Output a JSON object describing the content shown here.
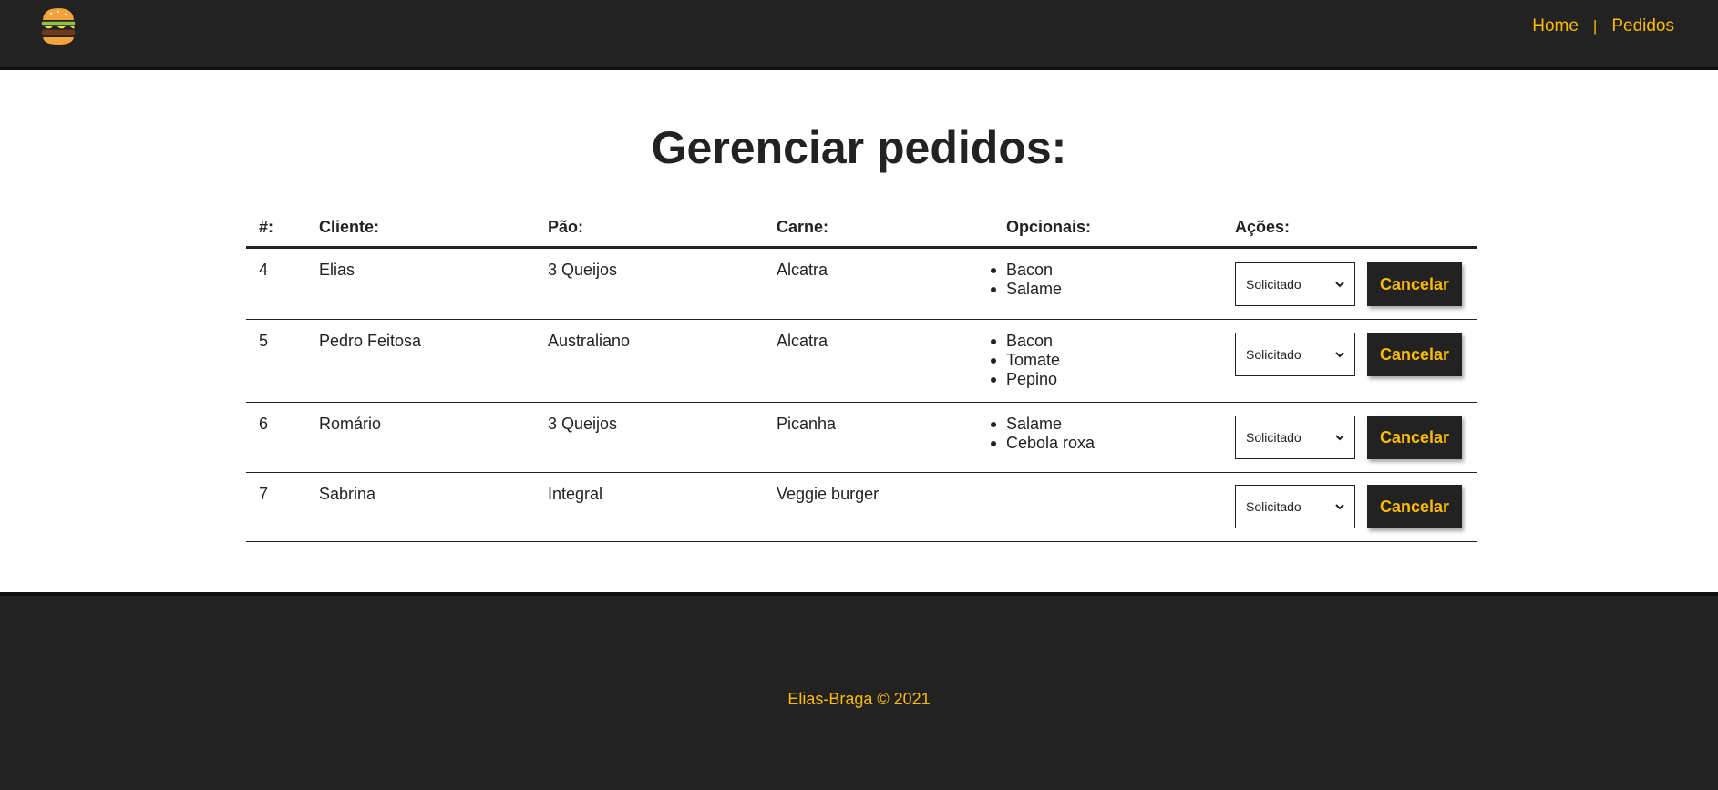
{
  "nav": {
    "logo": "burger-icon",
    "links": [
      "Home",
      "Pedidos"
    ]
  },
  "page": {
    "title": "Gerenciar pedidos:"
  },
  "table": {
    "headers": [
      "#:",
      "Cliente:",
      "Pão:",
      "Carne:",
      "Opcionais:",
      "Ações:"
    ],
    "rows": [
      {
        "id": "4",
        "cliente": "Elias",
        "pao": "3 Queijos",
        "carne": "Alcatra",
        "opcionais": [
          "Bacon",
          "Salame"
        ],
        "status": "Solicitado",
        "action": "Cancelar"
      },
      {
        "id": "5",
        "cliente": "Pedro Feitosa",
        "pao": "Australiano",
        "carne": "Alcatra",
        "opcionais": [
          "Bacon",
          "Tomate",
          "Pepino"
        ],
        "status": "Solicitado",
        "action": "Cancelar"
      },
      {
        "id": "6",
        "cliente": "Romário",
        "pao": "3 Queijos",
        "carne": "Picanha",
        "opcionais": [
          "Salame",
          "Cebola roxa"
        ],
        "status": "Solicitado",
        "action": "Cancelar"
      },
      {
        "id": "7",
        "cliente": "Sabrina",
        "pao": "Integral",
        "carne": "Veggie burger",
        "opcionais": [],
        "status": "Solicitado",
        "action": "Cancelar"
      }
    ]
  },
  "footer": {
    "text": "Elias-Braga © 2021"
  },
  "colors": {
    "accent": "#fcba03",
    "dark": "#222222"
  }
}
